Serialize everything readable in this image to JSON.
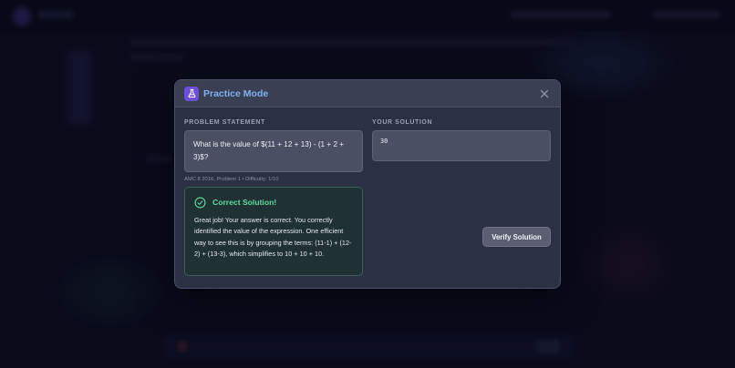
{
  "modal": {
    "title": "Practice Mode",
    "icon": "flask-icon",
    "close_icon": "close-icon"
  },
  "problem": {
    "section_label": "PROBLEM STATEMENT",
    "text": "What is the value of $(11 + 12 + 13) - (1 + 2 + 3)$?",
    "meta": "AMC 8 2016, Problem 1 • Difficulty: 1/10"
  },
  "result": {
    "icon": "check-circle-icon",
    "title": "Correct Solution!",
    "text": "Great job! Your answer is correct. You correctly identified the value of the expression. One efficient way to see this is by grouping the terms: (11-1) + (12-2) + (13-3), which simplifies to 10 + 10 + 10."
  },
  "solution": {
    "section_label": "YOUR SOLUTION",
    "value": "30",
    "verify_label": "Verify Solution"
  },
  "colors": {
    "accent_title": "#7fb1f2",
    "success": "#5fdc9d",
    "badge": "#6d4fd6"
  }
}
